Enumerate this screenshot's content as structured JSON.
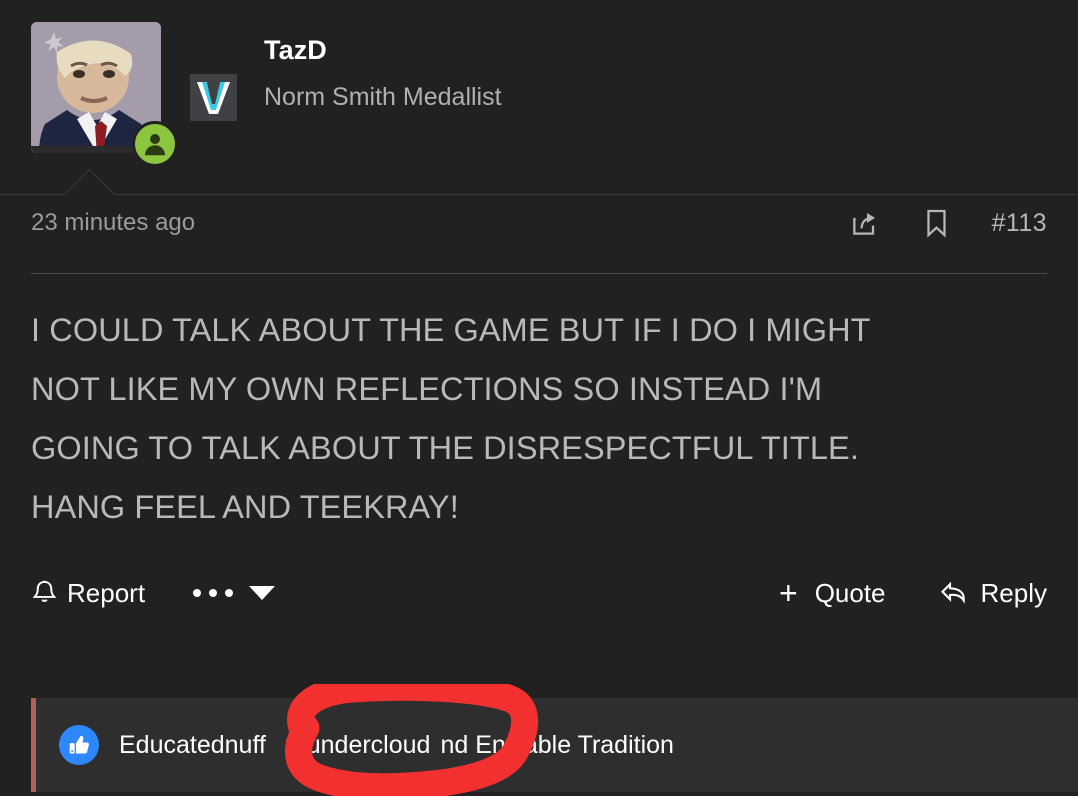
{
  "post": {
    "user": {
      "name": "TazD",
      "title": "Norm Smith Medallist",
      "avatar_icon": "user-photo-avatar",
      "status_icon": "online-status-icon",
      "badge_icon": "v-badge-icon"
    },
    "meta": {
      "timestamp": "23 minutes ago",
      "share_icon": "share-icon",
      "bookmark_icon": "bookmark-icon",
      "post_number": "#113"
    },
    "body_lines": [
      "I COULD TALK ABOUT THE GAME BUT IF I DO I MIGHT",
      "NOT LIKE MY OWN REFLECTIONS SO INSTEAD I'M",
      "GOING TO TALK ABOUT THE DISRESPECTFUL TITLE.",
      "HANG FEEL AND TEEKRAY!"
    ],
    "actions": {
      "report_label": "Report",
      "report_icon": "bell-icon",
      "more_icon": "ellipsis-icon",
      "caret_icon": "chevron-down-icon",
      "quote_label": "Quote",
      "quote_icon": "plus-icon",
      "reply_label": "Reply",
      "reply_icon": "reply-arrow-icon"
    },
    "reactions": {
      "like_icon": "thumbs-up-icon",
      "user_1": "Educatednuff",
      "user_2": "thundercloud",
      "trailing_text": "nd Enviable Tradition"
    },
    "annotation": {
      "shape": "hand-drawn-red-circle",
      "color": "#f23030",
      "target": "thundercloud"
    }
  },
  "colors": {
    "background": "#212121",
    "reaction_bar": "#2e2e2e",
    "accent_left": "#b2605a",
    "status_green": "#8cc63f",
    "like_blue": "#2d88ff",
    "annotation_red": "#f23030"
  }
}
